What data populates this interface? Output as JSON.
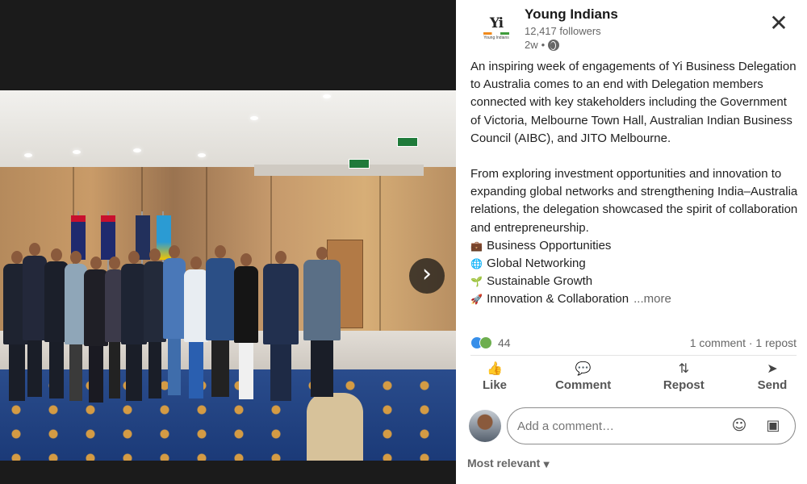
{
  "post": {
    "author_name": "Young Indians",
    "followers": "12,417 followers",
    "age": "2w",
    "logo_text": "Yi",
    "logo_sub": "Young Indians",
    "close_symbol": "✕",
    "paragraph1": "An inspiring week of engagements of Yi Business Delegation to Australia comes to an end with Delegation members connected with key stakeholders including the Government of Victoria, Melbourne Town Hall, Australian Indian Business Council (AIBC), and JITO Melbourne.",
    "paragraph2": "From exploring investment opportunities and innovation to expanding global networks and strengthening India–Australia relations, the delegation showcased the spirit of collaboration and entrepreneurship.",
    "tags": [
      {
        "emoji": "💼",
        "icon": "briefcase-icon",
        "text": "Business Opportunities"
      },
      {
        "emoji": "🌐",
        "icon": "globe-icon",
        "text": "Global Networking"
      },
      {
        "emoji": "🌱",
        "icon": "seedling-icon",
        "text": "Sustainable Growth"
      },
      {
        "emoji": "🚀",
        "icon": "rocket-icon",
        "text": "Innovation & Collaboration"
      }
    ],
    "more_link": "...more"
  },
  "stats": {
    "reaction_count": "44",
    "comments_reposts": "1 comment · 1 repost"
  },
  "actions": {
    "like": "Like",
    "comment": "Comment",
    "repost": "Repost",
    "send": "Send"
  },
  "comment_box": {
    "placeholder": "Add a comment…"
  },
  "sort": {
    "label": "Most relevant"
  },
  "viewer": {
    "next_symbol": "›"
  },
  "colors": {
    "background_dark": "#1b1b1b",
    "panel_bg": "#ffffff",
    "text_primary": "#1d1d1d",
    "text_secondary": "#666666",
    "like_blue": "#378fe9",
    "celebrate_green": "#6dae4f"
  }
}
